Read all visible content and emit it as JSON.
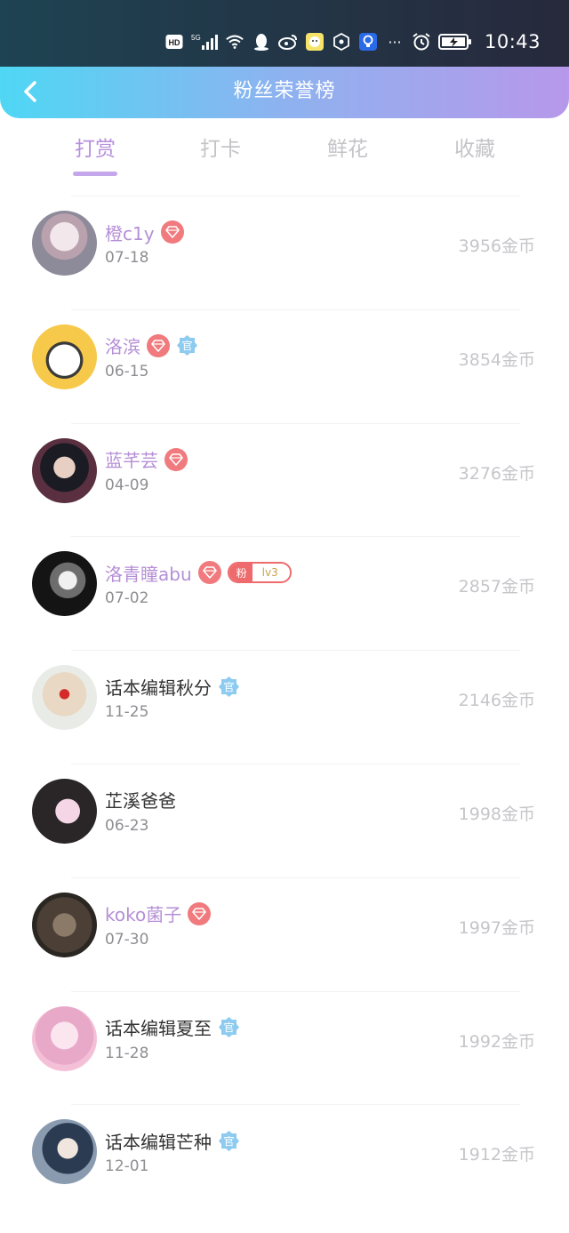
{
  "status_bar": {
    "time": "10:43",
    "network": "5G",
    "hd": "HD",
    "more": "···"
  },
  "header": {
    "title": "粉丝荣誉榜"
  },
  "tabs": [
    {
      "label": "打赏",
      "active": true
    },
    {
      "label": "打卡",
      "active": false
    },
    {
      "label": "鲜花",
      "active": false
    },
    {
      "label": "收藏",
      "active": false
    }
  ],
  "badges": {
    "guan": "官",
    "fan": "粉",
    "fan_level": "lv3"
  },
  "fans": [
    {
      "name": "橙c1y",
      "date": "07-18",
      "coins": "3956金币",
      "vip": true,
      "diamond": true,
      "guan": false,
      "fan": false
    },
    {
      "name": "洛滨",
      "date": "06-15",
      "coins": "3854金币",
      "vip": true,
      "diamond": true,
      "guan": true,
      "fan": false
    },
    {
      "name": "蓝芊芸",
      "date": "04-09",
      "coins": "3276金币",
      "vip": true,
      "diamond": true,
      "guan": false,
      "fan": false
    },
    {
      "name": "洛青瞳abu",
      "date": "07-02",
      "coins": "2857金币",
      "vip": true,
      "diamond": true,
      "guan": false,
      "fan": true
    },
    {
      "name": "话本编辑秋分",
      "date": "11-25",
      "coins": "2146金币",
      "vip": false,
      "diamond": false,
      "guan": true,
      "fan": false
    },
    {
      "name": "芷溪爸爸",
      "date": "06-23",
      "coins": "1998金币",
      "vip": false,
      "diamond": false,
      "guan": false,
      "fan": false
    },
    {
      "name": "koko菌子",
      "date": "07-30",
      "coins": "1997金币",
      "vip": true,
      "diamond": true,
      "guan": false,
      "fan": false
    },
    {
      "name": "话本编辑夏至",
      "date": "11-28",
      "coins": "1992金币",
      "vip": false,
      "diamond": false,
      "guan": true,
      "fan": false
    },
    {
      "name": "话本编辑芒种",
      "date": "12-01",
      "coins": "1912金币",
      "vip": false,
      "diamond": false,
      "guan": true,
      "fan": false
    }
  ],
  "colors": {
    "accent": "#b78fdc",
    "vip_name": "#b58fd6",
    "diamond": "#f07a7d",
    "guan": "#8ecbf0"
  }
}
